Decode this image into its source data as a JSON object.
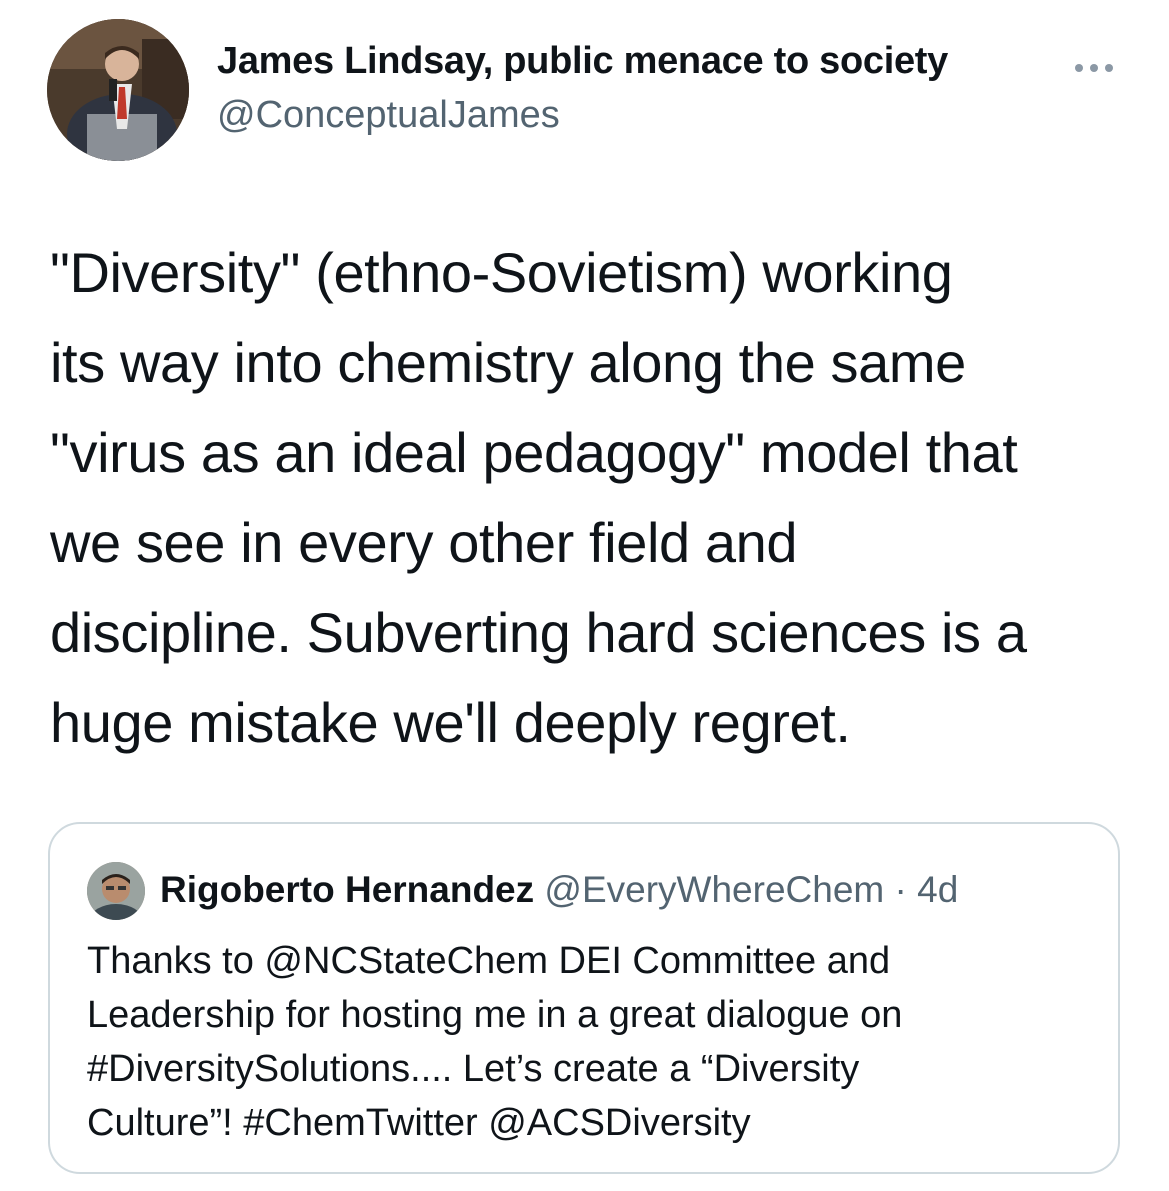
{
  "author": {
    "display_name": "James Lindsay, public menace to society",
    "handle": "@ConceptualJames"
  },
  "tweet": {
    "lines": [
      "\"Diversity\" (ethno-Sovietism) working",
      "its way into chemistry along the same",
      "\"virus as an ideal pedagogy\" model that",
      "we see in every other field and",
      "discipline. Subverting hard sciences is a",
      "huge mistake we'll deeply regret."
    ]
  },
  "quoted_tweet": {
    "display_name": "Rigoberto Hernandez",
    "handle": "@EveryWhereChem",
    "separator": " · ",
    "time": "4d",
    "lines": [
      "Thanks to @NCStateChem DEI Committee and",
      "Leadership for hosting me in a great dialogue on",
      "#DiversitySolutions.... Let’s create a “Diversity",
      "Culture”! #ChemTwitter @ACSDiversity"
    ]
  },
  "icons": {
    "more": "more-horizontal-icon"
  },
  "colors": {
    "text_primary": "#0f1419",
    "text_secondary": "#536471",
    "border": "#cfd9de",
    "more_icon": "#8b98a5"
  }
}
